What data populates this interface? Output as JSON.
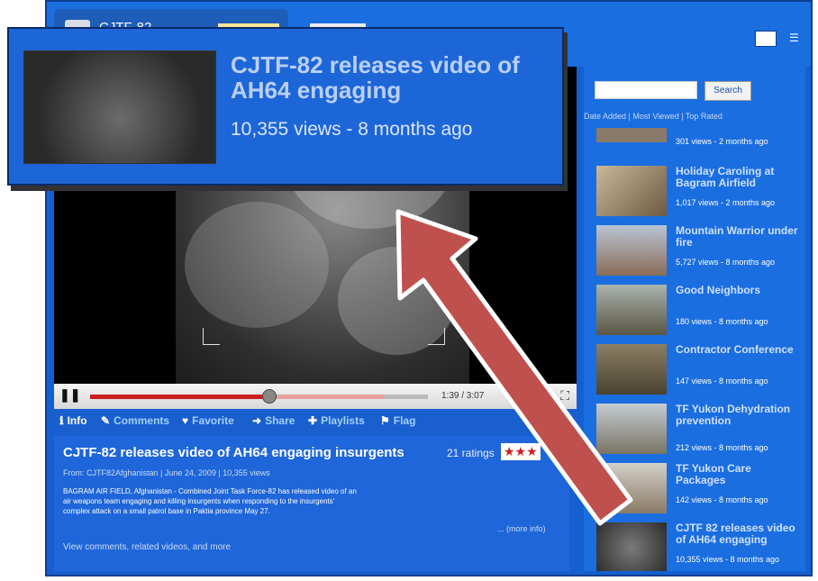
{
  "channel": {
    "name": "CJTF-82"
  },
  "player": {
    "time": "1:39 / 3:07",
    "progress_fraction": 0.53,
    "buffer_fraction": 0.87,
    "pause_icon": "pause-icon",
    "fullscreen_icon": "fullscreen-icon"
  },
  "actions": [
    {
      "label": "Info",
      "icon": "info-icon",
      "glyph": "ℹ"
    },
    {
      "label": "Comments",
      "icon": "comment-icon",
      "glyph": "✎"
    },
    {
      "label": "Favorite",
      "icon": "heart-icon",
      "glyph": "♥"
    },
    {
      "label": "Share",
      "icon": "share-icon",
      "glyph": "➜"
    },
    {
      "label": "Playlists",
      "icon": "plus-icon",
      "glyph": "✚"
    },
    {
      "label": "Flag",
      "icon": "flag-icon",
      "glyph": "⚑"
    }
  ],
  "video": {
    "title": "CJTF-82 releases video of AH64 engaging insurgents",
    "ratings": "21 ratings",
    "stars": "★★★",
    "byline": "From: CJTF82Afghanistan | June 24, 2009 | 10,355 views",
    "description": "BAGRAM AIR FIELD, Afghanistan - Combined Joint Task Force-82 has released video of an air weapons team engaging and killing insurgents when responding to the insurgents' complex attack on a small patrol base in Paktia province May 27.",
    "more_info": "... (more info)",
    "view_more": "View comments, related videos, and more"
  },
  "search": {
    "button": "Search"
  },
  "sort_links": "Date Added | Most Viewed | Top Rated",
  "sidebar_videos": [
    {
      "title": "",
      "meta": "301 views - 2 months ago"
    },
    {
      "title": "Holiday Caroling at Bagram Airfield",
      "meta": "1,017 views - 2 months ago"
    },
    {
      "title": "Mountain Warrior under fire",
      "meta": "5,727 views - 8 months ago"
    },
    {
      "title": "Good Neighbors",
      "meta": "180 views - 8 months ago"
    },
    {
      "title": "Contractor Conference",
      "meta": "147 views - 8 months ago"
    },
    {
      "title": "TF Yukon Dehydration prevention",
      "meta": "212 views - 8 months ago"
    },
    {
      "title": "TF Yukon Care Packages",
      "meta": "142 views - 8 months ago"
    },
    {
      "title": "CJTF 82 releases video of AH64 engaging",
      "meta": "10,355 views - 8 months ago"
    }
  ],
  "callout": {
    "title": "CJTF-82 releases video of AH64 engaging",
    "meta": "10,355 views - 8 months ago"
  },
  "colors": {
    "page_blue": "#1560d0",
    "sidebar_blue": "#1a6ee0",
    "arrow_red": "#c0504d",
    "progress_red": "#cc1e1e"
  }
}
